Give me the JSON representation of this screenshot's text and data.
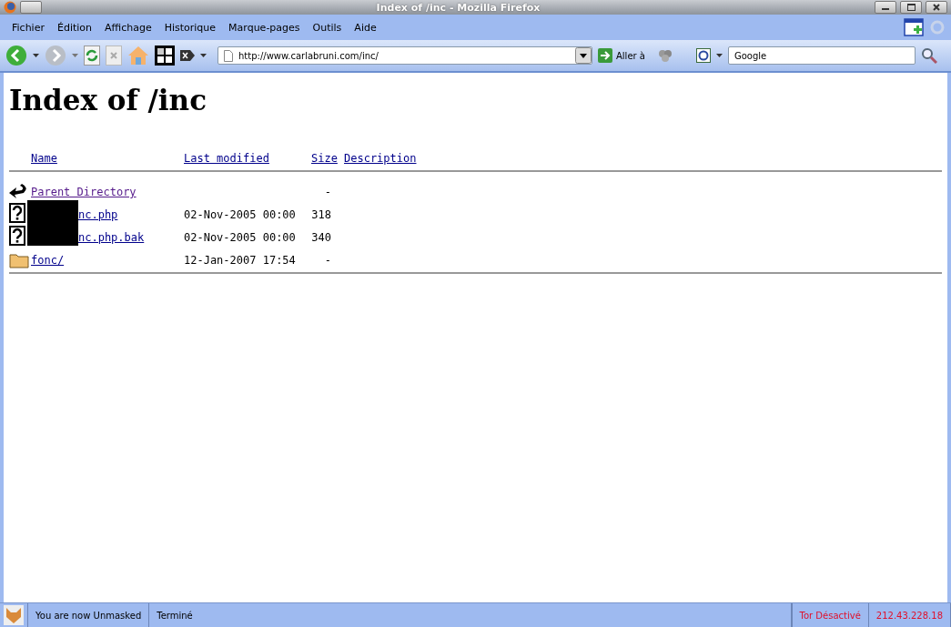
{
  "window": {
    "title": "Index of /inc - Mozilla Firefox"
  },
  "menu": [
    "Fichier",
    "Édition",
    "Affichage",
    "Historique",
    "Marque-pages",
    "Outils",
    "Aide"
  ],
  "toolbar": {
    "url": "http://www.carlabruni.com/inc/",
    "go_label": "Aller à",
    "search_value": "Google"
  },
  "page": {
    "heading": "Index of /inc",
    "columns": [
      "Name",
      "Last modified",
      "Size",
      "Description"
    ],
    "rows": [
      {
        "kind": "parent",
        "name": "Parent Directory",
        "modified": "",
        "size": "-",
        "redacted": false
      },
      {
        "kind": "file",
        "name": "nc.php",
        "modified": "02-Nov-2005 00:00",
        "size": "318",
        "redacted": true
      },
      {
        "kind": "file",
        "name": "nc.php.bak",
        "modified": "02-Nov-2005 00:00",
        "size": "340",
        "redacted": true
      },
      {
        "kind": "folder",
        "name": "fonc/",
        "modified": "12-Jan-2007 17:54",
        "size": "-",
        "redacted": false
      }
    ]
  },
  "status_bar": {
    "mask": "You are now Unmasked",
    "status": "Terminé",
    "tor": "Tor Désactivé",
    "ip": "212.43.228.18"
  }
}
